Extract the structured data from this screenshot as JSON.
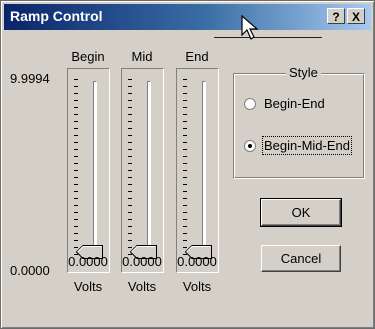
{
  "window": {
    "title": "Ramp Control",
    "help_label": "?",
    "close_label": "X"
  },
  "scale": {
    "max": "9.9994",
    "min": "0.0000"
  },
  "sliders": [
    {
      "name": "Begin",
      "value": "0.0000",
      "unit": "Volts",
      "level": 0
    },
    {
      "name": "Mid",
      "value": "0.0000",
      "unit": "Volts",
      "level": 0
    },
    {
      "name": "End",
      "value": "0.0000",
      "unit": "Volts",
      "level": 0
    }
  ],
  "style_group": {
    "legend": "Style",
    "options": [
      {
        "label": "Begin-End",
        "selected": false
      },
      {
        "label": "Begin-Mid-End",
        "selected": true
      }
    ]
  },
  "buttons": {
    "ok": "OK",
    "cancel": "Cancel"
  }
}
